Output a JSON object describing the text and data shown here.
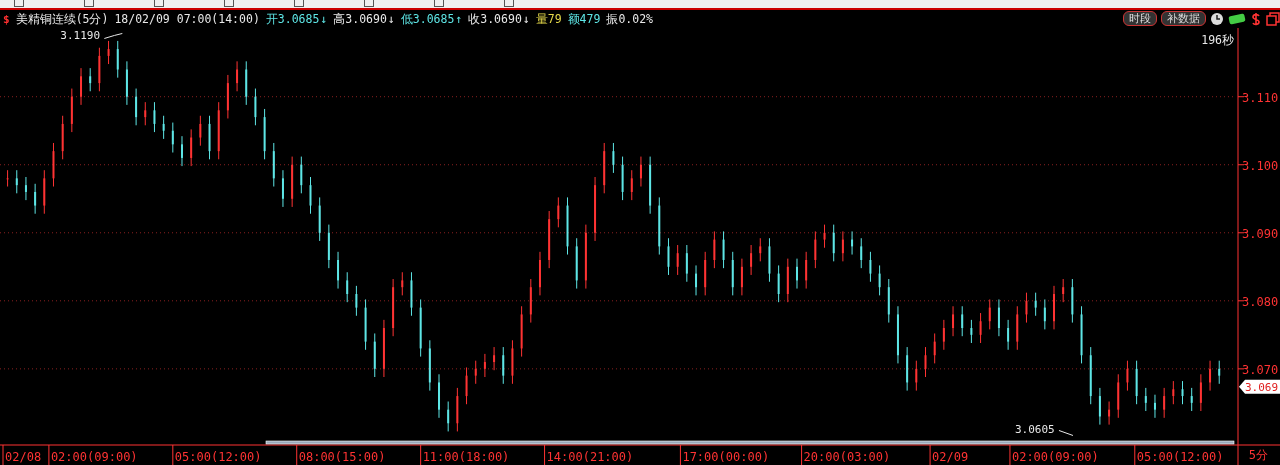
{
  "header": {
    "currency_mark": "$",
    "symbol": "美精铜连续(5分)",
    "datetime": "18/02/09 07:00(14:00)",
    "quotes": [
      {
        "label": "开3.0685",
        "arrow": "↓",
        "color": "#5ee6e6"
      },
      {
        "label": "高3.0690",
        "arrow": "↓",
        "color": "#e8e8e8"
      },
      {
        "label": "低3.0685",
        "arrow": "↑",
        "color": "#5ee6e6"
      },
      {
        "label": "收3.0690",
        "arrow": "↓",
        "color": "#e8e8e8"
      },
      {
        "label": "量79",
        "color": "#e6d94a"
      },
      {
        "label": "额479",
        "color": "#5ee6e6"
      },
      {
        "label": "振0.02%",
        "color": "#e8e8e8"
      }
    ],
    "buttons": [
      "时段",
      "补数据"
    ]
  },
  "countdown": "196秒",
  "chart": {
    "high_label": "3.1190",
    "low_label": "3.0605",
    "price_tag": "3.069",
    "y_axis": [
      "3.110",
      "3.100",
      "3.090",
      "3.080",
      "3.070"
    ],
    "x_axis": [
      "02/08",
      "02:00(09:00)",
      "05:00(12:00)",
      "08:00(15:00)",
      "11:00(18:00)",
      "14:00(21:00)",
      "17:00(00:00)",
      "20:00(03:00)",
      "02/09",
      "02:00(09:00)",
      "05:00(12:00)"
    ]
  },
  "period": "5分"
}
